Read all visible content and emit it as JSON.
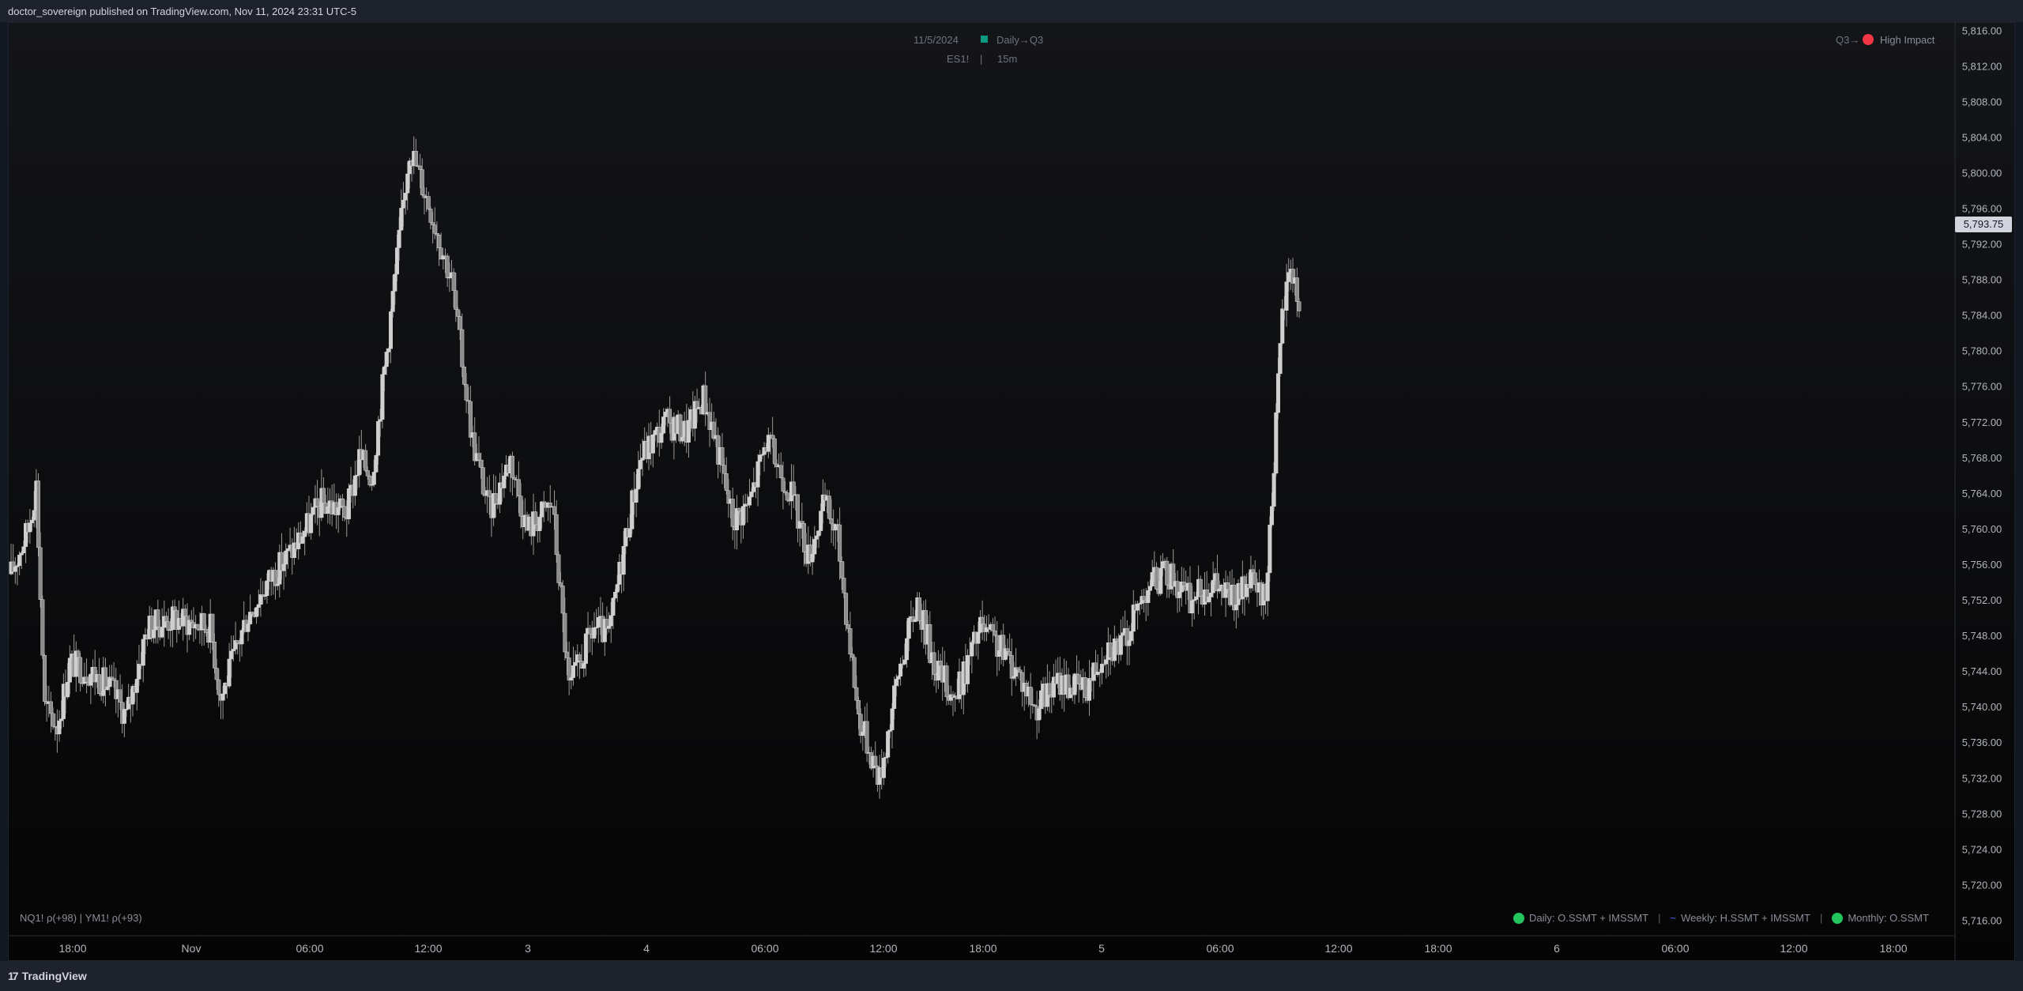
{
  "header": {
    "published": "doctor_sovereign published on TradingView.com, Nov 11, 2024 23:31 UTC-5",
    "date_label": "11/5/2024",
    "timeframe_label": "Daily→Q3",
    "symbol": "ES1!",
    "interval": "15m",
    "impact_prefix": "Q3→",
    "impact_label": "High Impact"
  },
  "footer": {
    "brand": "TradingView",
    "correlations": "NQ1! ρ(+98)  |  YM1! ρ(+93)",
    "legend": [
      {
        "label": "Daily: O.SSMT + IMSSMT",
        "icon": "green-dot-icon"
      },
      {
        "label": "Weekly: H.SSMT + IMSSMT",
        "icon": "wave-icon"
      },
      {
        "label": "Monthly: O.SSMT",
        "icon": "green-dot-icon"
      }
    ]
  },
  "colors": {
    "background": "#131722",
    "candle": "#c8c8c8",
    "high_impact": "#f23645",
    "legend_green": "#22c55e",
    "wave": "#3d6ef5"
  },
  "chart_data": {
    "type": "candlestick",
    "symbol": "ES1!",
    "interval": "15m",
    "last_price": "5,793.75",
    "ylim": [
      5714,
      5817
    ],
    "y_ticks": [
      "5,816.00",
      "5,812.00",
      "5,808.00",
      "5,804.00",
      "5,800.00",
      "5,796.00",
      "5,792.00",
      "5,788.00",
      "5,784.00",
      "5,780.00",
      "5,776.00",
      "5,772.00",
      "5,768.00",
      "5,764.00",
      "5,760.00",
      "5,756.00",
      "5,752.00",
      "5,748.00",
      "5,744.00",
      "5,740.00",
      "5,736.00",
      "5,732.00",
      "5,728.00",
      "5,724.00",
      "5,720.00",
      "5,716.00"
    ],
    "x_ticks": [
      "18:00",
      "Nov",
      "06:00",
      "12:00",
      "3",
      "4",
      "06:00",
      "12:00",
      "18:00",
      "5",
      "06:00",
      "12:00",
      "18:00",
      "6",
      "06:00",
      "12:00",
      "18:00"
    ],
    "path_points": [
      [
        0,
        5755
      ],
      [
        8,
        5760
      ],
      [
        12,
        5765
      ],
      [
        16,
        5740
      ],
      [
        22,
        5738
      ],
      [
        28,
        5745
      ],
      [
        38,
        5744
      ],
      [
        48,
        5742
      ],
      [
        55,
        5739
      ],
      [
        65,
        5749
      ],
      [
        78,
        5750
      ],
      [
        95,
        5749
      ],
      [
        100,
        5741
      ],
      [
        112,
        5750
      ],
      [
        122,
        5754
      ],
      [
        135,
        5758
      ],
      [
        148,
        5763
      ],
      [
        160,
        5762
      ],
      [
        166,
        5768
      ],
      [
        172,
        5766
      ],
      [
        180,
        5782
      ],
      [
        190,
        5803
      ],
      [
        200,
        5796
      ],
      [
        210,
        5788
      ],
      [
        220,
        5770
      ],
      [
        228,
        5762
      ],
      [
        238,
        5768
      ],
      [
        246,
        5760
      ],
      [
        258,
        5763
      ],
      [
        266,
        5742
      ],
      [
        278,
        5749
      ],
      [
        285,
        5748
      ],
      [
        292,
        5758
      ],
      [
        300,
        5768
      ],
      [
        312,
        5772
      ],
      [
        322,
        5771
      ],
      [
        330,
        5775
      ],
      [
        336,
        5770
      ],
      [
        344,
        5761
      ],
      [
        352,
        5763
      ],
      [
        360,
        5770
      ],
      [
        372,
        5764
      ],
      [
        380,
        5757
      ],
      [
        388,
        5763
      ],
      [
        394,
        5759
      ],
      [
        404,
        5739
      ],
      [
        414,
        5732
      ],
      [
        424,
        5745
      ],
      [
        432,
        5752
      ],
      [
        440,
        5745
      ],
      [
        450,
        5741
      ],
      [
        462,
        5749
      ],
      [
        470,
        5747
      ],
      [
        480,
        5744
      ],
      [
        488,
        5740
      ],
      [
        500,
        5743
      ],
      [
        512,
        5742
      ],
      [
        522,
        5747
      ],
      [
        530,
        5747
      ],
      [
        542,
        5754
      ],
      [
        552,
        5755
      ],
      [
        562,
        5752
      ],
      [
        572,
        5754
      ],
      [
        584,
        5752
      ],
      [
        590,
        5754
      ],
      [
        598,
        5752
      ],
      [
        602,
        5768
      ],
      [
        606,
        5784
      ],
      [
        610,
        5790
      ],
      [
        614,
        5785
      ]
    ]
  }
}
